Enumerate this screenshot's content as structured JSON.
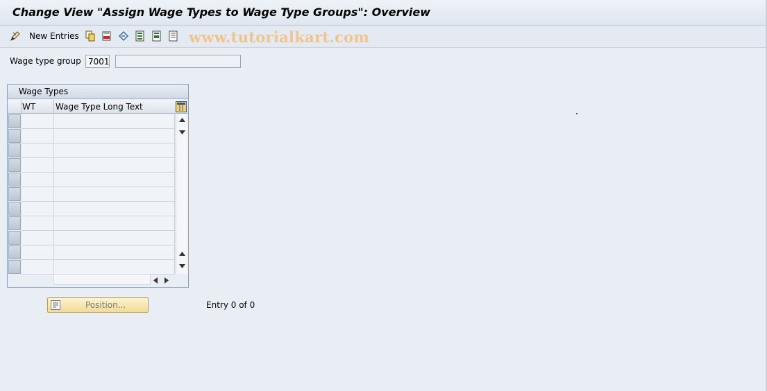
{
  "header": {
    "title": "Change View \"Assign Wage Types to Wage Type Groups\": Overview"
  },
  "toolbar": {
    "new_entries_label": "New Entries",
    "watermark": "www.tutorialkart.com",
    "icons": [
      "edit-pencil-icon",
      "copy-icon",
      "delete-icon",
      "undo-icon",
      "select-all-icon",
      "select-block-icon",
      "deselect-all-icon"
    ]
  },
  "selection": {
    "label": "Wage type group",
    "value": "7001",
    "text": ""
  },
  "table": {
    "title": "Wage Types",
    "columns": [
      "WT",
      "Wage Type Long Text"
    ],
    "rows": [
      [
        "",
        ""
      ],
      [
        "",
        ""
      ],
      [
        "",
        ""
      ],
      [
        "",
        ""
      ],
      [
        "",
        ""
      ],
      [
        "",
        ""
      ],
      [
        "",
        ""
      ],
      [
        "",
        ""
      ],
      [
        "",
        ""
      ],
      [
        "",
        ""
      ],
      [
        "",
        ""
      ]
    ]
  },
  "footer": {
    "position_button_label": "Position...",
    "entry_info": "Entry 0 of 0"
  }
}
